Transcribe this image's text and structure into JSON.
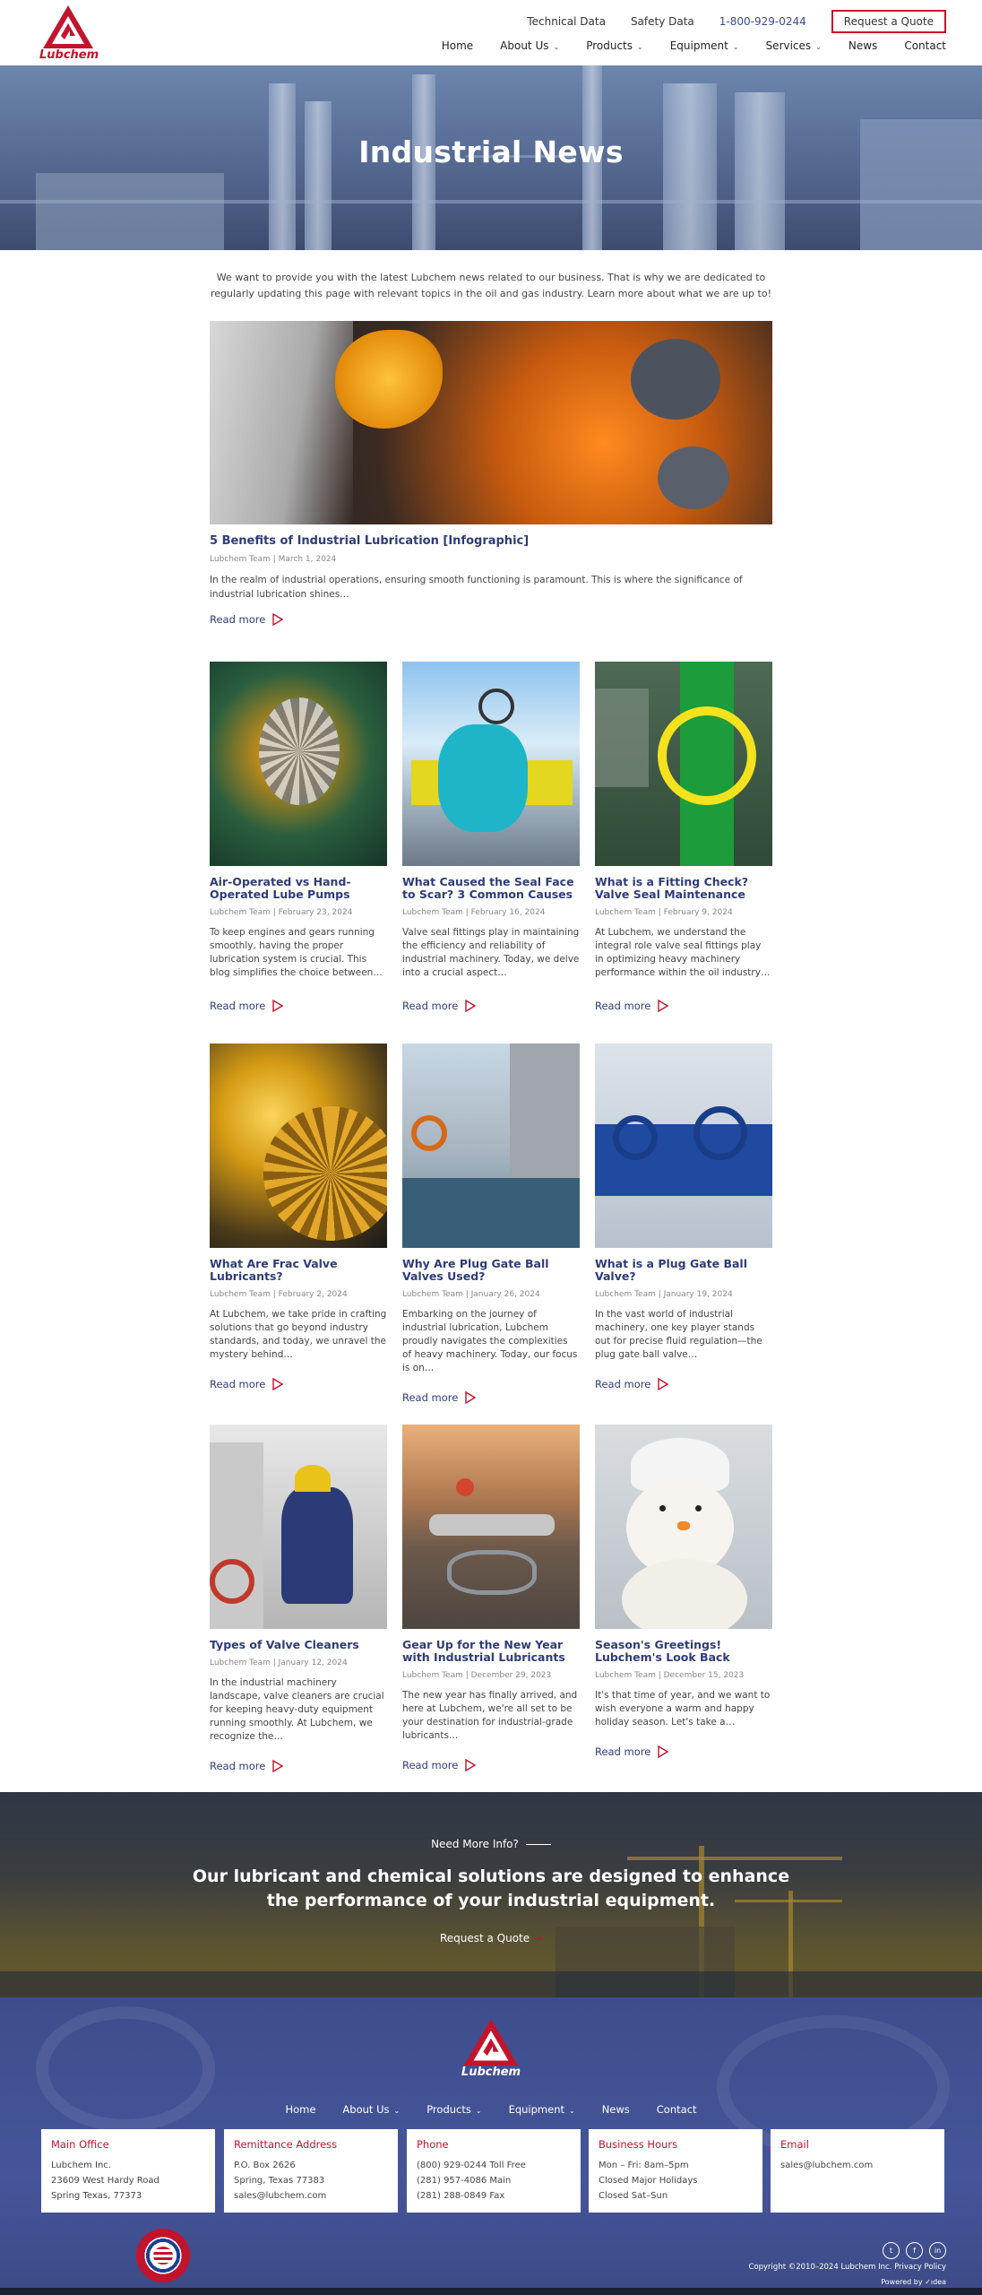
{
  "brand": {
    "name": "Lubchem",
    "accent": "#c3142d",
    "navy": "#2f3c78"
  },
  "topbar": {
    "technical_data": "Technical Data",
    "safety_data": "Safety Data",
    "phone": "1-800-929-0244",
    "quote_button": "Request a Quote"
  },
  "nav": [
    {
      "label": "Home",
      "dropdown": false
    },
    {
      "label": "About Us",
      "dropdown": true
    },
    {
      "label": "Products",
      "dropdown": true
    },
    {
      "label": "Equipment",
      "dropdown": true
    },
    {
      "label": "Services",
      "dropdown": true
    },
    {
      "label": "News",
      "dropdown": false
    },
    {
      "label": "Contact",
      "dropdown": false
    }
  ],
  "hero": {
    "title": "Industrial News"
  },
  "intro": "We want to provide you with the latest Lubchem news related to our business. That is why we are dedicated to regularly updating this page with relevant topics in the oil and gas industry. Learn more about what we are up to!",
  "featured": {
    "title": "5 Benefits of Industrial Lubrication [Infographic]",
    "meta": "Lubchem Team | March 1, 2024",
    "excerpt": "In the realm of industrial operations, ensuring smooth functioning is paramount. This is where the significance of industrial lubrication shines…",
    "read_more": "Read more"
  },
  "posts": [
    {
      "title": "Air-Operated vs Hand-Operated Lube Pumps",
      "meta": "Lubchem Team | February 23, 2024",
      "excerpt": "To keep engines and gears running smoothly, having the proper lubrication system is crucial. This blog simplifies the choice between…",
      "read_more": "Read more"
    },
    {
      "title": "What Caused the Seal Face to Scar? 3 Common Causes",
      "meta": "Lubchem Team | February 16, 2024",
      "excerpt": "Valve seal fittings play in maintaining the efficiency and reliability of industrial machinery. Today, we delve into a crucial aspect…",
      "read_more": "Read more"
    },
    {
      "title": "What is a Fitting Check? Valve Seal Maintenance",
      "meta": "Lubchem Team | February 9, 2024",
      "excerpt": "At Lubchem, we understand the integral role valve seal fittings play in optimizing heavy machinery performance within the oil industry…",
      "read_more": "Read more"
    },
    {
      "title": "What Are Frac Valve Lubricants?",
      "meta": "Lubchem Team | February 2, 2024",
      "excerpt": "At Lubchem, we take pride in crafting solutions that go beyond industry standards, and today, we unravel the mystery behind…",
      "read_more": "Read more"
    },
    {
      "title": "Why Are Plug Gate Ball Valves Used?",
      "meta": "Lubchem Team | January 26, 2024",
      "excerpt": "Embarking on the journey of industrial lubrication, Lubchem proudly navigates the complexities of heavy machinery. Today, our focus is on…",
      "read_more": "Read more"
    },
    {
      "title": "What is a Plug Gate Ball Valve?",
      "meta": "Lubchem Team | January 19, 2024",
      "excerpt": "In the vast world of industrial machinery, one key player stands out for precise fluid regulation—the plug gate ball valve…",
      "read_more": "Read more"
    },
    {
      "title": "Types of Valve Cleaners",
      "meta": "Lubchem Team | January 12, 2024",
      "excerpt": "In the industrial machinery landscape, valve cleaners are crucial for keeping heavy-duty equipment running smoothly. At Lubchem, we recognize the…",
      "read_more": "Read more"
    },
    {
      "title": "Gear Up for the New Year with Industrial Lubricants",
      "meta": "Lubchem Team | December 29, 2023",
      "excerpt": "The new year has finally arrived, and here at Lubchem, we're all set to be your destination for industrial-grade lubricants…",
      "read_more": "Read more"
    },
    {
      "title": "Season's Greetings! Lubchem's Look Back",
      "meta": "Lubchem Team | December 15, 2023",
      "excerpt": "It's that time of year, and we want to wish everyone a warm and happy holiday season. Let's take a…",
      "read_more": "Read more"
    }
  ],
  "cta": {
    "kicker": "Need More Info?",
    "headline_line1": "Our lubricant and chemical solutions are designed to enhance",
    "headline_line2": "the performance of your industrial equipment.",
    "link": "Request a Quote"
  },
  "footer": {
    "nav": [
      {
        "label": "Home",
        "dropdown": false
      },
      {
        "label": "About Us",
        "dropdown": true
      },
      {
        "label": "Products",
        "dropdown": true
      },
      {
        "label": "Equipment",
        "dropdown": true
      },
      {
        "label": "News",
        "dropdown": false
      },
      {
        "label": "Contact",
        "dropdown": false
      }
    ],
    "boxes": [
      {
        "title": "Main Office",
        "lines": [
          "Lubchem Inc.",
          "23609 West Hardy Road",
          "Spring Texas, 77373"
        ]
      },
      {
        "title": "Remittance Address",
        "lines": [
          "P.O. Box 2626",
          "Spring, Texas 77383",
          "sales@lubchem.com"
        ]
      },
      {
        "title": "Phone",
        "lines": [
          "(800) 929-0244 Toll Free",
          "(281) 957-4086 Main",
          "(281) 288-0849 Fax"
        ]
      },
      {
        "title": "Business Hours",
        "lines": [
          "Mon – Fri: 8am–5pm",
          "Closed Major Holidays",
          "Closed Sat–Sun"
        ]
      },
      {
        "title": "Email",
        "lines": [
          "sales@lubchem.com"
        ]
      }
    ],
    "social_icons": [
      "twitter-icon",
      "facebook-icon",
      "linkedin-icon"
    ],
    "social_glyphs": [
      "t",
      "f",
      "in"
    ],
    "copyright": "Copyright ©2010–2024 Lubchem Inc. Privacy Policy",
    "powered": "Powered by ✓ıdea"
  }
}
